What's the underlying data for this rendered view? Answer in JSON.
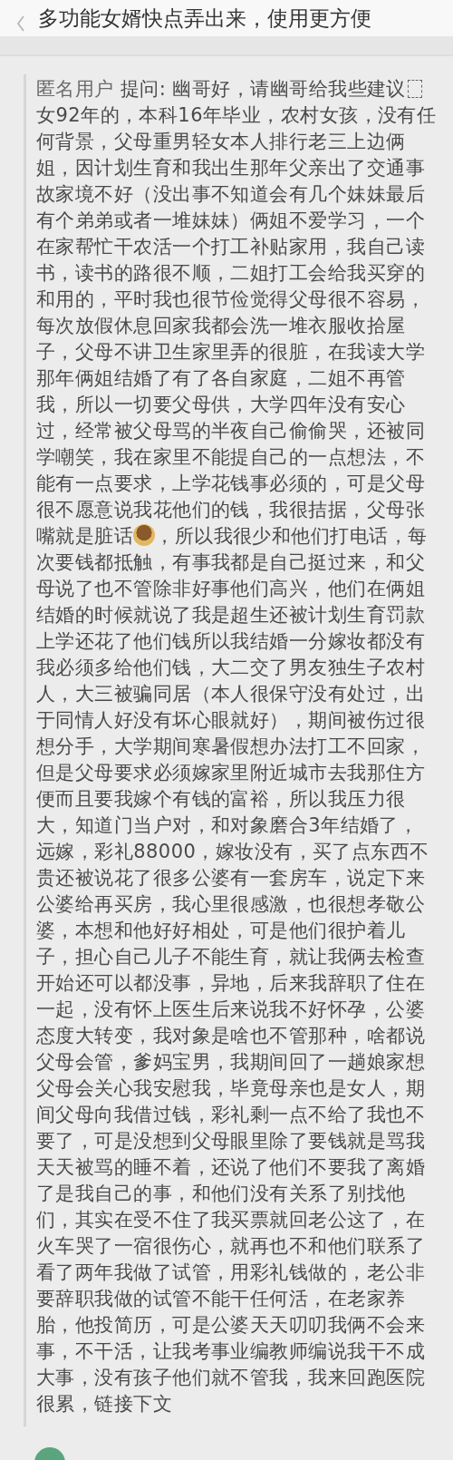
{
  "header": {
    "title": "多功能女婿快点弄出来，使用更方便"
  },
  "post": {
    "author": "匿名用户",
    "lines": [
      {
        "segments": [
          {
            "kind": "text",
            "text": " 提问: 幽哥好，请幽哥给我些建议"
          },
          {
            "kind": "object_mark"
          }
        ]
      },
      {
        "segments": [
          {
            "kind": "text",
            "text": "女92年的，本科16年毕业，农村女孩，没有任"
          }
        ]
      },
      {
        "segments": [
          {
            "kind": "text",
            "text": "何背景，父母重男轻女本人排行老三上边俩"
          }
        ]
      },
      {
        "segments": [
          {
            "kind": "text",
            "text": "姐，因计划生育和我出生那年父亲出了交通事"
          }
        ]
      },
      {
        "segments": [
          {
            "kind": "text",
            "text": "故家境不好（没出事不知道会有几个妹妹最后"
          }
        ]
      },
      {
        "segments": [
          {
            "kind": "text",
            "text": "有个弟弟或者一堆妹妹）俩姐不爱学习，一个"
          }
        ]
      },
      {
        "segments": [
          {
            "kind": "text",
            "text": "在家帮忙干农活一个打工补贴家用，我自己读"
          }
        ]
      },
      {
        "segments": [
          {
            "kind": "text",
            "text": "书，读书的路很不顺，二姐打工会给我买穿的"
          }
        ]
      },
      {
        "segments": [
          {
            "kind": "text",
            "text": "和用的，平时我也很节俭觉得父母很不容易，"
          }
        ]
      },
      {
        "segments": [
          {
            "kind": "text",
            "text": "每次放假休息回家我都会洗一堆衣服收拾屋"
          }
        ]
      },
      {
        "segments": [
          {
            "kind": "text",
            "text": "子，父母不讲卫生家里弄的很脏，在我读大学"
          }
        ]
      },
      {
        "segments": [
          {
            "kind": "text",
            "text": "那年俩姐结婚了有了各自家庭，二姐不再管"
          }
        ]
      },
      {
        "segments": [
          {
            "kind": "text",
            "text": "我，所以一切要父母供，大学四年没有安心"
          }
        ]
      },
      {
        "segments": [
          {
            "kind": "text",
            "text": "过，经常被父母骂的半夜自己偷偷哭，还被同"
          }
        ]
      },
      {
        "segments": [
          {
            "kind": "text",
            "text": "学嘲笑，我在家里不能提自己的一点想法，不"
          }
        ]
      },
      {
        "segments": [
          {
            "kind": "text",
            "text": "能有一点要求，上学花钱事必须的，可是父母"
          }
        ]
      },
      {
        "segments": [
          {
            "kind": "text",
            "text": "很不愿意说我花他们的钱，我很拮据，父母张"
          }
        ]
      },
      {
        "segments": [
          {
            "kind": "text",
            "text": "嘴就是脏话"
          },
          {
            "kind": "sticker"
          },
          {
            "kind": "text",
            "text": "，所以我很少和他们打电话，每"
          }
        ]
      },
      {
        "segments": [
          {
            "kind": "text",
            "text": "次要钱都抵触，有事我都是自己挺过来，和父"
          }
        ]
      },
      {
        "segments": [
          {
            "kind": "text",
            "text": "母说了也不管除非好事他们高兴，他们在俩姐"
          }
        ]
      },
      {
        "segments": [
          {
            "kind": "text",
            "text": "结婚的时候就说了我是超生还被计划生育罚款"
          }
        ]
      },
      {
        "segments": [
          {
            "kind": "text",
            "text": "上学还花了他们钱所以我结婚一分嫁妆都没有"
          }
        ]
      },
      {
        "segments": [
          {
            "kind": "text",
            "text": "我必须多给他们钱，大二交了男友独生子农村"
          }
        ]
      },
      {
        "segments": [
          {
            "kind": "text",
            "text": "人，大三被骗同居（本人很保守没有处过，出"
          }
        ]
      },
      {
        "segments": [
          {
            "kind": "text",
            "text": "于同情人好没有坏心眼就好），期间被伤过很"
          }
        ]
      },
      {
        "segments": [
          {
            "kind": "text",
            "text": "想分手，大学期间寒暑假想办法打工不回家，"
          }
        ]
      },
      {
        "segments": [
          {
            "kind": "text",
            "text": "但是父母要求必须嫁家里附近城市去我那住方"
          }
        ]
      },
      {
        "segments": [
          {
            "kind": "text",
            "text": "便而且要我嫁个有钱的富裕，所以我压力很"
          }
        ]
      },
      {
        "segments": [
          {
            "kind": "text",
            "text": "大，知道门当户对，和对象磨合3年结婚了，"
          }
        ]
      },
      {
        "segments": [
          {
            "kind": "text",
            "text": "远嫁，彩礼88000，嫁妆没有，买了点东西不"
          }
        ]
      },
      {
        "segments": [
          {
            "kind": "text",
            "text": "贵还被说花了很多公婆有一套房车，说定下来"
          }
        ]
      },
      {
        "segments": [
          {
            "kind": "text",
            "text": "公婆给再买房，我心里很感激，也很想孝敬公"
          }
        ]
      },
      {
        "segments": [
          {
            "kind": "text",
            "text": "婆，本想和他好好相处，可是他们很护着儿"
          }
        ]
      },
      {
        "segments": [
          {
            "kind": "text",
            "text": "子，担心自己儿子不能生育，就让我俩去检查"
          }
        ]
      },
      {
        "segments": [
          {
            "kind": "text",
            "text": "开始还可以都没事，异地，后来我辞职了住在"
          }
        ]
      },
      {
        "segments": [
          {
            "kind": "text",
            "text": "一起，没有怀上医生后来说我不好怀孕，公婆"
          }
        ]
      },
      {
        "segments": [
          {
            "kind": "text",
            "text": "态度大转变，我对象是啥也不管那种，啥都说"
          }
        ]
      },
      {
        "segments": [
          {
            "kind": "text",
            "text": "父母会管，爹妈宝男，我期间回了一趟娘家想"
          }
        ]
      },
      {
        "segments": [
          {
            "kind": "text",
            "text": "父母会关心我安慰我，毕竟母亲也是女人，期"
          }
        ]
      },
      {
        "segments": [
          {
            "kind": "text",
            "text": "间父母向我借过钱，彩礼剩一点不给了我也不"
          }
        ]
      },
      {
        "segments": [
          {
            "kind": "text",
            "text": "要了，可是没想到父母眼里除了要钱就是骂我"
          }
        ]
      },
      {
        "segments": [
          {
            "kind": "text",
            "text": "天天被骂的睡不着，还说了他们不要我了离婚"
          }
        ]
      },
      {
        "segments": [
          {
            "kind": "text",
            "text": "了是我自己的事，和他们没有关系了别找他"
          }
        ]
      },
      {
        "segments": [
          {
            "kind": "text",
            "text": "们，其实在受不住了我买票就回老公这了，在"
          }
        ]
      },
      {
        "segments": [
          {
            "kind": "text",
            "text": "火车哭了一宿很伤心，就再也不和他们联系了"
          }
        ]
      },
      {
        "segments": [
          {
            "kind": "text",
            "text": "看了两年我做了试管，用彩礼钱做的，老公非"
          }
        ]
      },
      {
        "segments": [
          {
            "kind": "text",
            "text": "要辞职我做的试管不能干任何活，在老家养"
          }
        ]
      },
      {
        "segments": [
          {
            "kind": "text",
            "text": "胎，他投简历，可是公婆天天叨叨我俩不会来"
          }
        ]
      },
      {
        "segments": [
          {
            "kind": "text",
            "text": "事，不干活，让我考事业编教师编说我干不成"
          }
        ]
      },
      {
        "segments": [
          {
            "kind": "text",
            "text": "大事，没有孩子他们就不管我，我来回跑医院"
          }
        ]
      },
      {
        "segments": [
          {
            "kind": "text",
            "text": "很累，链接下文"
          }
        ]
      }
    ]
  }
}
